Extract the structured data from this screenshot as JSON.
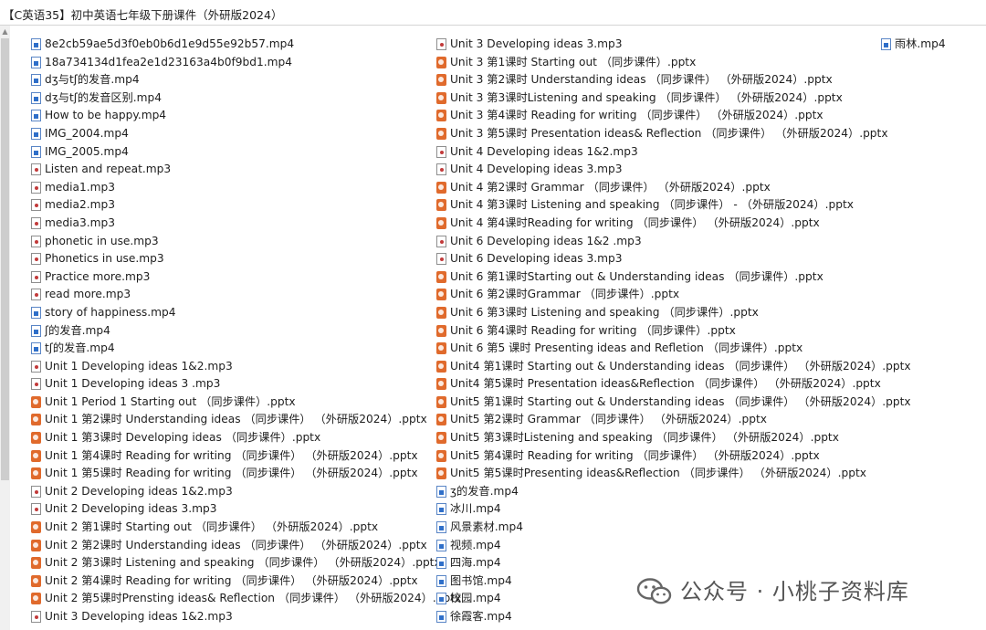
{
  "window": {
    "title": "【C英语35】初中英语七年级下册课件（外研版2024）"
  },
  "files": {
    "column1": [
      {
        "name": "8e2cb59ae5d3f0eb0b6d1e9d55e92b57.mp4",
        "type": "mp4"
      },
      {
        "name": "18a734134d1fea2e1d23163a4b0f9bd1.mp4",
        "type": "mp4"
      },
      {
        "name": "dʒ与tʃ的发音.mp4",
        "type": "mp4"
      },
      {
        "name": "dʒ与tʃ的发音区别.mp4",
        "type": "mp4"
      },
      {
        "name": "How to be happy.mp4",
        "type": "mp4"
      },
      {
        "name": "IMG_2004.mp4",
        "type": "mp4"
      },
      {
        "name": "IMG_2005.mp4",
        "type": "mp4"
      },
      {
        "name": "Listen and repeat.mp3",
        "type": "mp3"
      },
      {
        "name": "media1.mp3",
        "type": "mp3"
      },
      {
        "name": "media2.mp3",
        "type": "mp3"
      },
      {
        "name": "media3.mp3",
        "type": "mp3"
      },
      {
        "name": "phonetic in use.mp3",
        "type": "mp3"
      },
      {
        "name": "Phonetics in use.mp3",
        "type": "mp3"
      },
      {
        "name": "Practice more.mp3",
        "type": "mp3"
      },
      {
        "name": "read more.mp3",
        "type": "mp3"
      },
      {
        "name": "story of happiness.mp4",
        "type": "mp4"
      },
      {
        "name": "ʃ的发音.mp4",
        "type": "mp4"
      },
      {
        "name": "tʃ的发音.mp4",
        "type": "mp4"
      },
      {
        "name": "Unit 1 Developing ideas 1&2.mp3",
        "type": "mp3"
      },
      {
        "name": "Unit 1 Developing ideas 3 .mp3",
        "type": "mp3"
      },
      {
        "name": "Unit 1 Period 1 Starting out （同步课件）.pptx",
        "type": "pptx"
      },
      {
        "name": "Unit 1 第2课时 Understanding ideas （同步课件） （外研版2024）.pptx",
        "type": "pptx"
      },
      {
        "name": "Unit 1 第3课时 Developing ideas （同步课件）.pptx",
        "type": "pptx"
      },
      {
        "name": "Unit 1 第4课时 Reading for writing （同步课件） （外研版2024）.pptx",
        "type": "pptx"
      },
      {
        "name": "Unit 1 第5课时 Reading for writing （同步课件） （外研版2024）.pptx",
        "type": "pptx"
      },
      {
        "name": "Unit 2 Developing ideas 1&2.mp3",
        "type": "mp3"
      },
      {
        "name": "Unit 2 Developing ideas 3.mp3",
        "type": "mp3"
      },
      {
        "name": "Unit 2 第1课时 Starting out （同步课件） （外研版2024）.pptx",
        "type": "pptx"
      },
      {
        "name": "Unit 2 第2课时 Understanding ideas （同步课件） （外研版2024）.pptx",
        "type": "pptx"
      },
      {
        "name": "Unit 2 第3课时 Listening and speaking （同步课件） （外研版2024）.pptx",
        "type": "pptx"
      },
      {
        "name": "Unit 2 第4课时 Reading for writing （同步课件） （外研版2024）.pptx",
        "type": "pptx"
      },
      {
        "name": "Unit 2 第5课时Prensting ideas& Reflection （同步课件） （外研版2024）.pptx",
        "type": "pptx"
      },
      {
        "name": "Unit 3 Developing ideas 1&2.mp3",
        "type": "mp3"
      }
    ],
    "column2": [
      {
        "name": "Unit 3 Developing ideas 3.mp3",
        "type": "mp3"
      },
      {
        "name": "Unit 3 第1课时 Starting out （同步课件）.pptx",
        "type": "pptx"
      },
      {
        "name": "Unit 3 第2课时 Understanding ideas （同步课件） （外研版2024）.pptx",
        "type": "pptx"
      },
      {
        "name": "Unit 3 第3课时Listening and speaking （同步课件） （外研版2024）.pptx",
        "type": "pptx"
      },
      {
        "name": "Unit 3 第4课时 Reading for writing （同步课件） （外研版2024）.pptx",
        "type": "pptx"
      },
      {
        "name": "Unit 3 第5课时 Presentation ideas& Reflection （同步课件） （外研版2024）.pptx",
        "type": "pptx"
      },
      {
        "name": "Unit 4 Developing ideas 1&2.mp3",
        "type": "mp3"
      },
      {
        "name": "Unit 4 Developing ideas 3.mp3",
        "type": "mp3"
      },
      {
        "name": "Unit 4 第2课时 Grammar （同步课件） （外研版2024）.pptx",
        "type": "pptx"
      },
      {
        "name": "Unit 4 第3课时 Listening and speaking （同步课件） - （外研版2024）.pptx",
        "type": "pptx"
      },
      {
        "name": "Unit 4 第4课时Reading for writing （同步课件） （外研版2024）.pptx",
        "type": "pptx"
      },
      {
        "name": "Unit 6 Developing ideas 1&2 .mp3",
        "type": "mp3"
      },
      {
        "name": "Unit 6 Developing ideas 3.mp3",
        "type": "mp3"
      },
      {
        "name": "Unit 6 第1课时Starting out & Understanding ideas （同步课件）.pptx",
        "type": "pptx"
      },
      {
        "name": "Unit 6 第2课时Grammar （同步课件）.pptx",
        "type": "pptx"
      },
      {
        "name": "Unit 6 第3课时 Listening and speaking （同步课件）.pptx",
        "type": "pptx"
      },
      {
        "name": "Unit 6 第4课时 Reading for writing （同步课件）.pptx",
        "type": "pptx"
      },
      {
        "name": "Unit 6 第5 课时 Presenting ideas and Refletion （同步课件）.pptx",
        "type": "pptx"
      },
      {
        "name": "Unit4 第1课时 Starting out & Understanding ideas （同步课件） （外研版2024）.pptx",
        "type": "pptx"
      },
      {
        "name": "Unit4 第5课时 Presentation ideas&Reflection （同步课件） （外研版2024）.pptx",
        "type": "pptx"
      },
      {
        "name": "Unit5 第1课时 Starting out & Understanding ideas （同步课件） （外研版2024）.pptx",
        "type": "pptx"
      },
      {
        "name": "Unit5 第2课时 Grammar （同步课件） （外研版2024）.pptx",
        "type": "pptx"
      },
      {
        "name": "Unit5 第3课时Listening and speaking （同步课件） （外研版2024）.pptx",
        "type": "pptx"
      },
      {
        "name": "Unit5 第4课时 Reading for writing （同步课件） （外研版2024）.pptx",
        "type": "pptx"
      },
      {
        "name": "Unit5 第5课时Presenting ideas&Reflection （同步课件） （外研版2024）.pptx",
        "type": "pptx"
      },
      {
        "name": "ʒ的发音.mp4",
        "type": "mp4"
      },
      {
        "name": "冰川.mp4",
        "type": "mp4"
      },
      {
        "name": "风景素材.mp4",
        "type": "mp4"
      },
      {
        "name": "视频.mp4",
        "type": "mp4"
      },
      {
        "name": "四海.mp4",
        "type": "mp4"
      },
      {
        "name": "图书馆.mp4",
        "type": "mp4"
      },
      {
        "name": "校园.mp4",
        "type": "mp4"
      },
      {
        "name": "徐霞客.mp4",
        "type": "mp4"
      }
    ],
    "column3": [
      {
        "name": "雨林.mp4",
        "type": "mp4"
      }
    ]
  },
  "icons": {
    "mp4": "video-file-icon",
    "mp3": "audio-file-icon",
    "pptx": "powerpoint-file-icon"
  },
  "watermark": {
    "text": "公众号 · 小桃子资料库",
    "logo": "wechat-logo-icon"
  },
  "colors": {
    "pptx_icon": "#e06a2c",
    "mp4_icon": "#2f6fc9",
    "mp3_icon": "#c23a3a",
    "text": "#1e1e1e",
    "watermark": "#555555"
  }
}
